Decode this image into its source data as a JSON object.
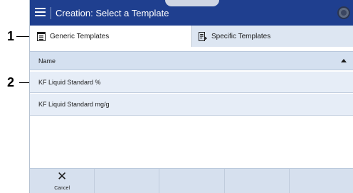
{
  "callouts": [
    "1",
    "2"
  ],
  "header": {
    "title": "Creation: Select a Template",
    "menu_icon": "hamburger-menu-icon",
    "status_icon": "status-indicator-icon"
  },
  "tabs": [
    {
      "label": "Generic Templates",
      "icon": "template-list-icon",
      "selected": true
    },
    {
      "label": "Specific Templates",
      "icon": "template-import-icon",
      "selected": false
    }
  ],
  "table": {
    "column_header": "Name",
    "sort_icon": "sort-ascending-icon",
    "rows": [
      {
        "name": "KF Liquid Standard %"
      },
      {
        "name": "KF Liquid Standard mg/g"
      }
    ]
  },
  "bottom_bar": {
    "cancel_label": "Cancel",
    "cancel_icon": "close-icon"
  },
  "colors": {
    "titlebar": "#1f3f8f",
    "tab_inactive": "#dde6f2",
    "row_background": "#e6edf7",
    "header_background": "#d4e0f0"
  }
}
